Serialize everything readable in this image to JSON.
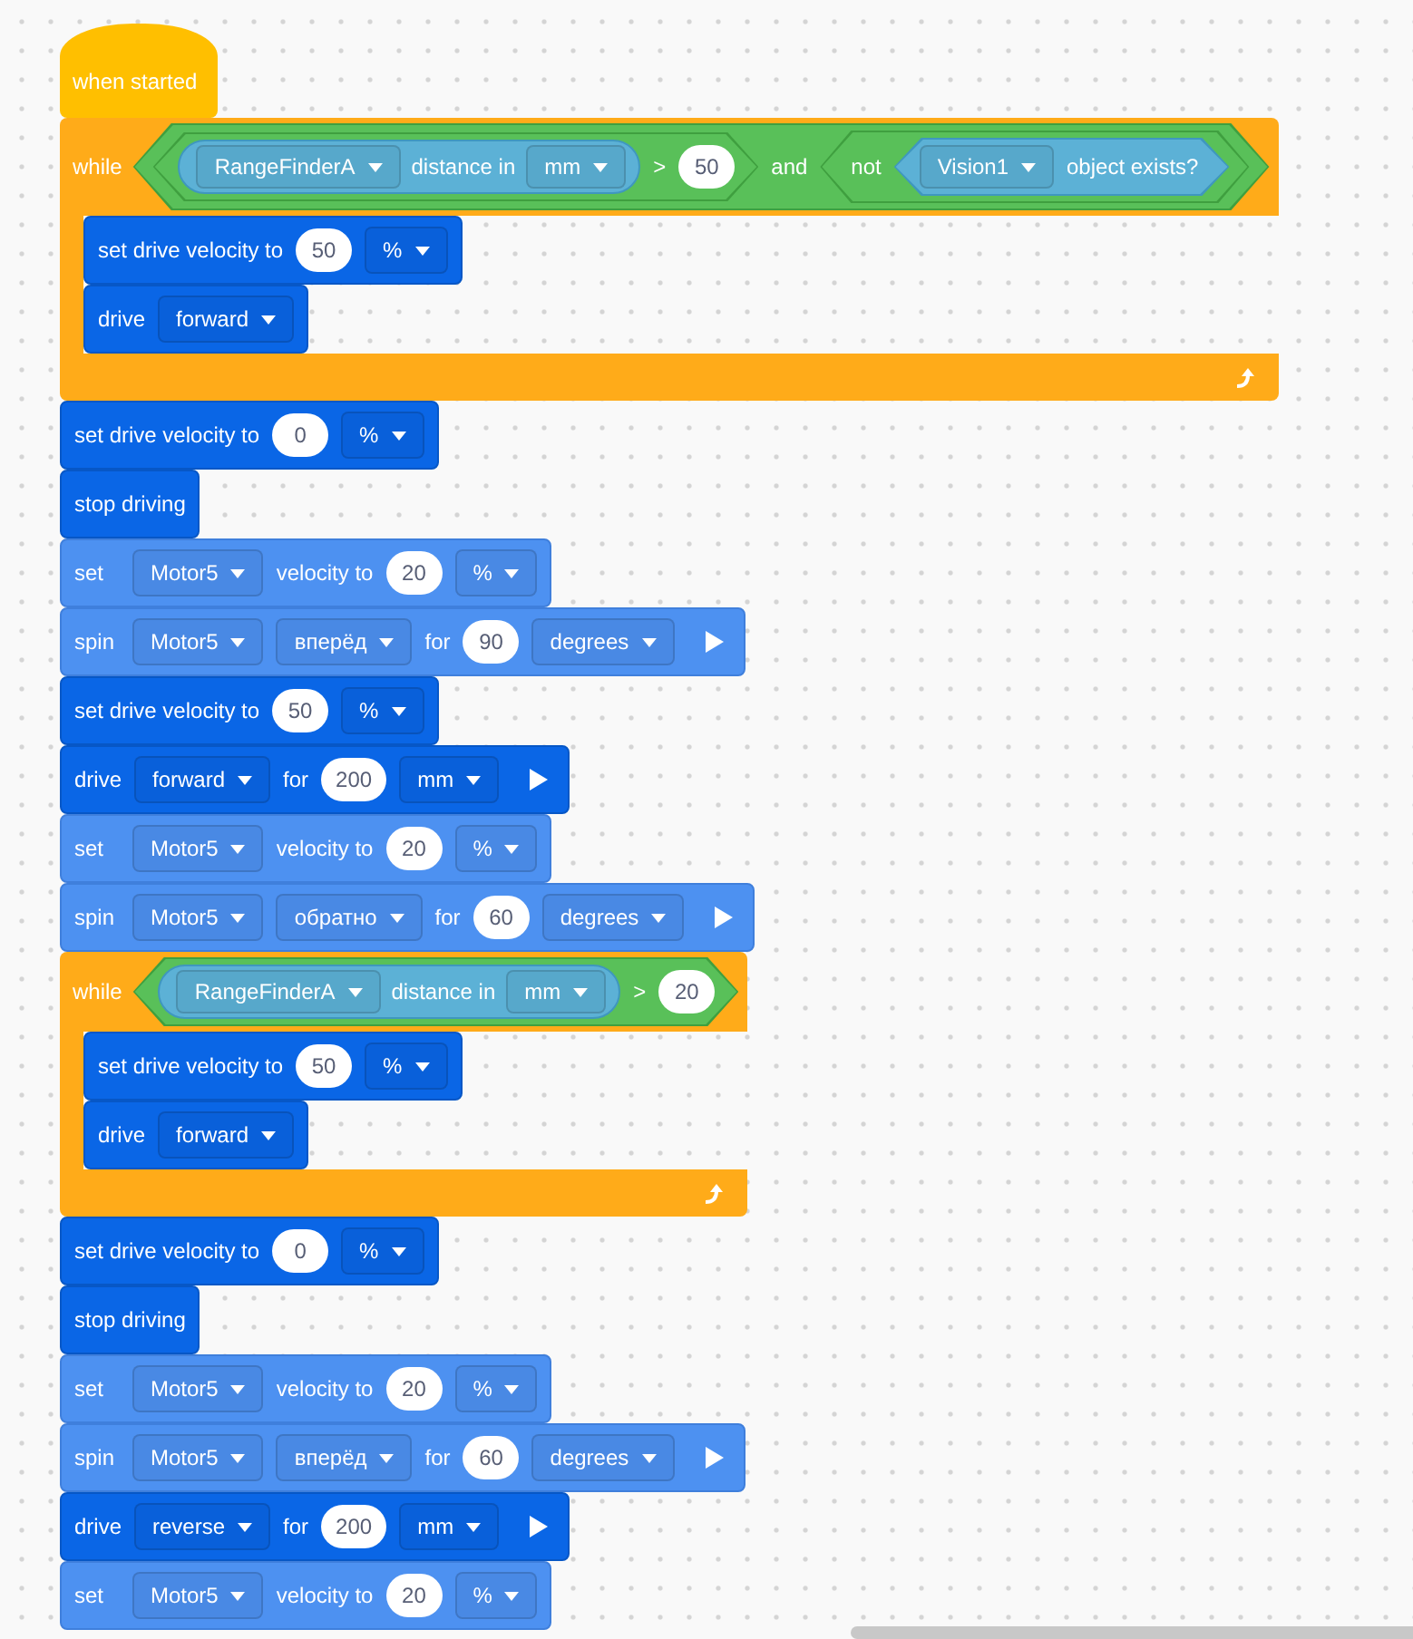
{
  "workspace": {
    "script": {
      "hat": {
        "label": "when started"
      },
      "blocks": [
        {
          "kind": "while",
          "label": "while",
          "condition": {
            "kind": "and",
            "parts": [
              {
                "kind": "compare",
                "parts": [
                  {
                    "kind": "reporter",
                    "parts": [
                      {
                        "kind": "dropdown",
                        "text": "RangeFinderA"
                      },
                      {
                        "kind": "text",
                        "text": "distance in"
                      },
                      {
                        "kind": "dropdown",
                        "text": "mm"
                      }
                    ]
                  },
                  {
                    "kind": "text",
                    "text": ">"
                  },
                  {
                    "kind": "number",
                    "text": "50"
                  }
                ]
              },
              {
                "kind": "text",
                "text": "and"
              },
              {
                "kind": "not",
                "parts": [
                  {
                    "kind": "text",
                    "text": "not"
                  },
                  {
                    "kind": "sensing",
                    "parts": [
                      {
                        "kind": "dropdown",
                        "text": "Vision1"
                      },
                      {
                        "kind": "text",
                        "text": "object exists?"
                      }
                    ]
                  }
                ]
              }
            ]
          },
          "children": [
            {
              "kind": "drivetrain",
              "parts": [
                {
                  "kind": "text",
                  "text": "set drive velocity to"
                },
                {
                  "kind": "number",
                  "text": "50"
                },
                {
                  "kind": "dropdown",
                  "text": "%"
                }
              ]
            },
            {
              "kind": "drivetrain",
              "parts": [
                {
                  "kind": "text",
                  "text": "drive"
                },
                {
                  "kind": "dropdown",
                  "text": "forward"
                }
              ]
            }
          ]
        },
        {
          "kind": "drivetrain",
          "parts": [
            {
              "kind": "text",
              "text": "set drive velocity to"
            },
            {
              "kind": "number",
              "text": "0"
            },
            {
              "kind": "dropdown",
              "text": "%"
            }
          ]
        },
        {
          "kind": "drivetrain",
          "parts": [
            {
              "kind": "text",
              "text": "stop driving"
            }
          ]
        },
        {
          "kind": "motor",
          "parts": [
            {
              "kind": "text",
              "text": "set"
            },
            {
              "kind": "dropdown",
              "text": "Motor5"
            },
            {
              "kind": "text",
              "text": "velocity to"
            },
            {
              "kind": "number",
              "text": "20"
            },
            {
              "kind": "dropdown",
              "text": "%"
            }
          ]
        },
        {
          "kind": "motor",
          "parts": [
            {
              "kind": "text",
              "text": "spin"
            },
            {
              "kind": "dropdown",
              "text": "Motor5"
            },
            {
              "kind": "dropdown",
              "text": "вперёд"
            },
            {
              "kind": "text",
              "text": "for"
            },
            {
              "kind": "number",
              "text": "90"
            },
            {
              "kind": "dropdown",
              "text": "degrees"
            },
            {
              "kind": "run"
            }
          ]
        },
        {
          "kind": "drivetrain",
          "parts": [
            {
              "kind": "text",
              "text": "set drive velocity to"
            },
            {
              "kind": "number",
              "text": "50"
            },
            {
              "kind": "dropdown",
              "text": "%"
            }
          ]
        },
        {
          "kind": "drivetrain",
          "parts": [
            {
              "kind": "text",
              "text": "drive"
            },
            {
              "kind": "dropdown",
              "text": "forward"
            },
            {
              "kind": "text",
              "text": "for"
            },
            {
              "kind": "number",
              "text": "200"
            },
            {
              "kind": "dropdown",
              "text": "mm"
            },
            {
              "kind": "run"
            }
          ]
        },
        {
          "kind": "motor",
          "parts": [
            {
              "kind": "text",
              "text": "set"
            },
            {
              "kind": "dropdown",
              "text": "Motor5"
            },
            {
              "kind": "text",
              "text": "velocity to"
            },
            {
              "kind": "number",
              "text": "20"
            },
            {
              "kind": "dropdown",
              "text": "%"
            }
          ]
        },
        {
          "kind": "motor",
          "parts": [
            {
              "kind": "text",
              "text": "spin"
            },
            {
              "kind": "dropdown",
              "text": "Motor5"
            },
            {
              "kind": "dropdown",
              "text": "обратно"
            },
            {
              "kind": "text",
              "text": "for"
            },
            {
              "kind": "number",
              "text": "60"
            },
            {
              "kind": "dropdown",
              "text": "degrees"
            },
            {
              "kind": "run"
            }
          ]
        },
        {
          "kind": "while",
          "label": "while",
          "condition": {
            "kind": "compare",
            "parts": [
              {
                "kind": "reporter",
                "parts": [
                  {
                    "kind": "dropdown",
                    "text": "RangeFinderA"
                  },
                  {
                    "kind": "text",
                    "text": "distance in"
                  },
                  {
                    "kind": "dropdown",
                    "text": "mm"
                  }
                ]
              },
              {
                "kind": "text",
                "text": ">"
              },
              {
                "kind": "number",
                "text": "20"
              }
            ]
          },
          "children": [
            {
              "kind": "drivetrain",
              "parts": [
                {
                  "kind": "text",
                  "text": "set drive velocity to"
                },
                {
                  "kind": "number",
                  "text": "50"
                },
                {
                  "kind": "dropdown",
                  "text": "%"
                }
              ]
            },
            {
              "kind": "drivetrain",
              "parts": [
                {
                  "kind": "text",
                  "text": "drive"
                },
                {
                  "kind": "dropdown",
                  "text": "forward"
                }
              ]
            }
          ]
        },
        {
          "kind": "drivetrain",
          "parts": [
            {
              "kind": "text",
              "text": "set drive velocity to"
            },
            {
              "kind": "number",
              "text": "0"
            },
            {
              "kind": "dropdown",
              "text": "%"
            }
          ]
        },
        {
          "kind": "drivetrain",
          "parts": [
            {
              "kind": "text",
              "text": "stop driving"
            }
          ]
        },
        {
          "kind": "motor",
          "parts": [
            {
              "kind": "text",
              "text": "set"
            },
            {
              "kind": "dropdown",
              "text": "Motor5"
            },
            {
              "kind": "text",
              "text": "velocity to"
            },
            {
              "kind": "number",
              "text": "20"
            },
            {
              "kind": "dropdown",
              "text": "%"
            }
          ]
        },
        {
          "kind": "motor",
          "parts": [
            {
              "kind": "text",
              "text": "spin"
            },
            {
              "kind": "dropdown",
              "text": "Motor5"
            },
            {
              "kind": "dropdown",
              "text": "вперёд"
            },
            {
              "kind": "text",
              "text": "for"
            },
            {
              "kind": "number",
              "text": "60"
            },
            {
              "kind": "dropdown",
              "text": "degrees"
            },
            {
              "kind": "run"
            }
          ]
        },
        {
          "kind": "drivetrain",
          "parts": [
            {
              "kind": "text",
              "text": "drive"
            },
            {
              "kind": "dropdown",
              "text": "reverse"
            },
            {
              "kind": "text",
              "text": "for"
            },
            {
              "kind": "number",
              "text": "200"
            },
            {
              "kind": "dropdown",
              "text": "mm"
            },
            {
              "kind": "run"
            }
          ]
        },
        {
          "kind": "motor",
          "parts": [
            {
              "kind": "text",
              "text": "set"
            },
            {
              "kind": "dropdown",
              "text": "Motor5"
            },
            {
              "kind": "text",
              "text": "velocity to"
            },
            {
              "kind": "number",
              "text": "20"
            },
            {
              "kind": "dropdown",
              "text": "%"
            }
          ]
        }
      ]
    }
  }
}
